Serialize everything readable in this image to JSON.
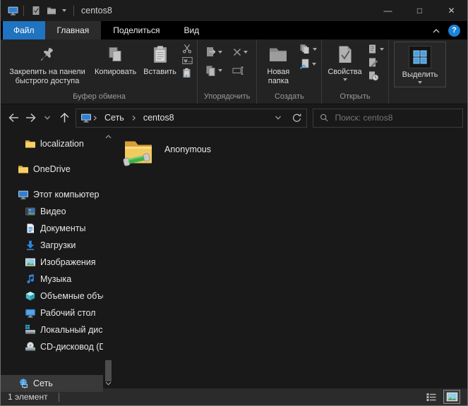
{
  "window": {
    "title": "centos8",
    "controls": {
      "minimize": "—",
      "maximize": "□",
      "close": "✕"
    },
    "help_glyph": "?"
  },
  "tabs": {
    "file": "Файл",
    "home": "Главная",
    "share": "Поделиться",
    "view": "Вид",
    "active": "Главная"
  },
  "ribbon": {
    "clipboard": {
      "pin": "Закрепить на панели быстрого доступа",
      "copy": "Копировать",
      "paste": "Вставить",
      "group": "Буфер обмена"
    },
    "organize": {
      "group": "Упорядочить"
    },
    "create": {
      "new_folder": "Новая папка",
      "group": "Создать"
    },
    "open": {
      "properties": "Свойства",
      "group": "Открыть"
    },
    "select": {
      "label": "Выделить"
    }
  },
  "nav": {
    "crumbs": [
      "Сеть",
      "centos8"
    ]
  },
  "search": {
    "placeholder": "Поиск: centos8"
  },
  "sidebar": {
    "items": [
      {
        "label": "localization"
      },
      {
        "label": "OneDrive"
      },
      {
        "label": "Этот компьютер"
      },
      {
        "label": "Видео"
      },
      {
        "label": "Документы"
      },
      {
        "label": "Загрузки"
      },
      {
        "label": "Изображения"
      },
      {
        "label": "Музыка"
      },
      {
        "label": "Объемные объекты"
      },
      {
        "label": "Рабочий стол"
      },
      {
        "label": "Локальный диск (C:)"
      },
      {
        "label": "CD-дисковод (D:)"
      },
      {
        "label": "Сеть"
      }
    ]
  },
  "content": {
    "files": [
      {
        "name": "Anonymous",
        "icon": "shared-folder-icon"
      }
    ]
  },
  "status": {
    "count": "1 элемент"
  },
  "colors": {
    "accent_blue": "#1f73bf",
    "folder_yellow": "#f2cb5e",
    "share_pipe_green": "#3cb24a",
    "selection_gray": "#393939"
  }
}
